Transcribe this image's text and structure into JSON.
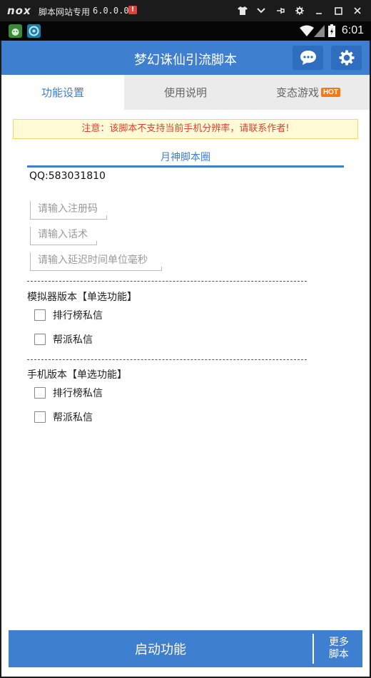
{
  "emulator": {
    "logo": "nox",
    "title": "脚本网站专用",
    "version": "6.0.0.0",
    "alert": "!",
    "controls": [
      "shirt-icon",
      "chevron-down-icon",
      "pin-icon",
      "gear-icon",
      "minimize-icon",
      "maximize-icon",
      "close-icon"
    ]
  },
  "status_bar": {
    "time": "6:01"
  },
  "app": {
    "title": "梦幻诛仙引流脚本",
    "tabs": [
      {
        "label": "功能设置",
        "active": true
      },
      {
        "label": "使用说明",
        "active": false
      },
      {
        "label": "变态游戏",
        "badge": "HOT",
        "active": false
      }
    ],
    "notice": "注意：该脚本不支持当前手机分辨率，请联系作者!",
    "section_title": "月神脚本圈",
    "qq": "QQ:583031810",
    "inputs": {
      "reg_code_placeholder": "请输入注册码",
      "script_placeholder": "请输入话术",
      "delay_placeholder": "请输入延迟时间单位毫秒"
    },
    "emulator_group": {
      "label": "模拟器版本【单选功能】",
      "options": [
        "排行榜私信",
        "帮派私信"
      ]
    },
    "phone_group": {
      "label": "手机版本【单选功能】",
      "options": [
        "排行榜私信",
        "帮派私信"
      ]
    },
    "start_button": "启动功能",
    "more_button": [
      "更多",
      "脚本"
    ]
  },
  "colors": {
    "primary": "#3f7fd0",
    "hot_badge": "#f57a16",
    "notice_text": "#e0412f",
    "notice_bg": "#fffbd6"
  }
}
